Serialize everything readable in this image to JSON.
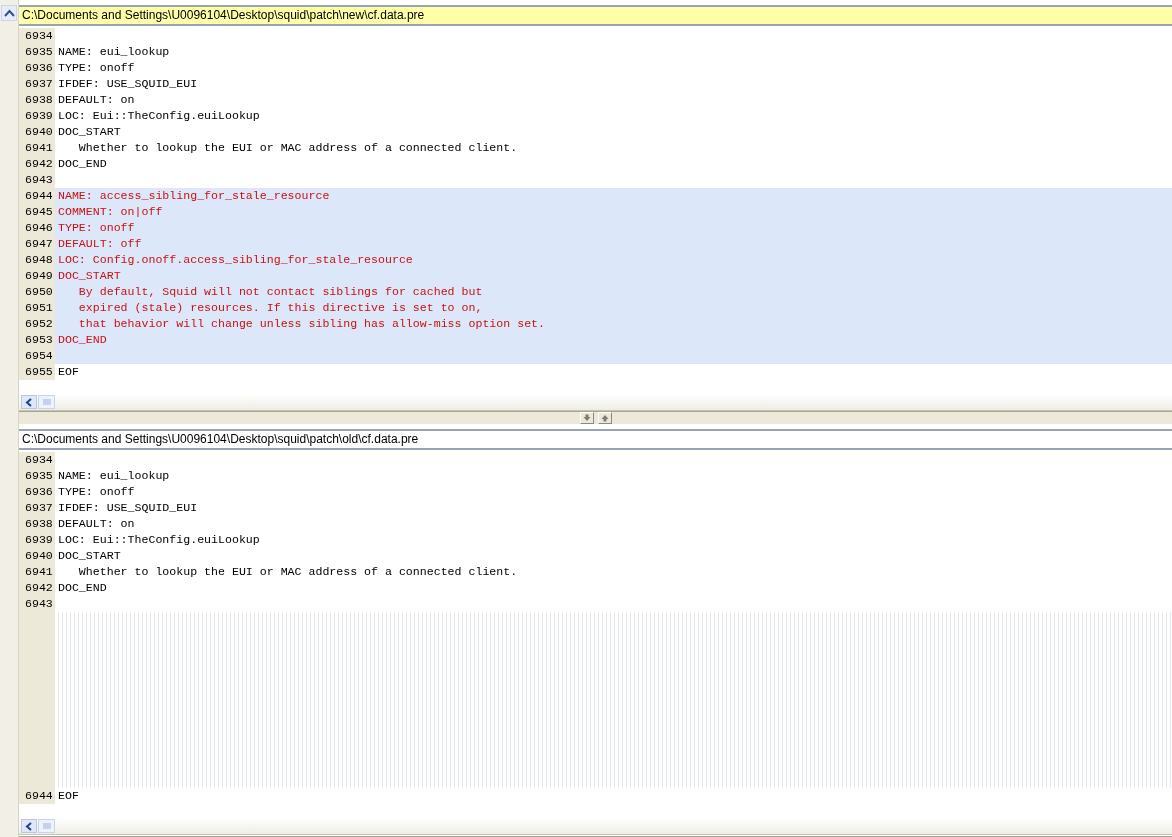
{
  "panes": [
    {
      "path": "C:\\Documents and Settings\\U0096104\\Desktop\\squid\\patch\\new\\cf.data.pre",
      "active": true,
      "lines": [
        {
          "kind": "line",
          "number": "6934",
          "changed": false
        },
        {
          "kind": "line",
          "number": "6935",
          "text": "NAME: eui_lookup",
          "changed": false
        },
        {
          "kind": "line",
          "number": "6936",
          "text": "TYPE: onoff",
          "changed": false
        },
        {
          "kind": "line",
          "number": "6937",
          "text": "IFDEF: USE_SQUID_EUI",
          "changed": false
        },
        {
          "kind": "line",
          "number": "6938",
          "text": "DEFAULT: on",
          "changed": false
        },
        {
          "kind": "line",
          "number": "6939",
          "text": "LOC: Eui::TheConfig.euiLookup",
          "changed": false
        },
        {
          "kind": "line",
          "number": "6940",
          "text": "DOC_START",
          "changed": false
        },
        {
          "kind": "line",
          "number": "6941",
          "text": "   Whether to lookup the EUI or MAC address of a connected client.",
          "changed": false
        },
        {
          "kind": "line",
          "number": "6942",
          "text": "DOC_END",
          "changed": false
        },
        {
          "kind": "line",
          "number": "6943",
          "changed": false
        },
        {
          "kind": "line",
          "number": "6944",
          "text": "NAME: access_sibling_for_stale_resource",
          "changed": true
        },
        {
          "kind": "line",
          "number": "6945",
          "text": "COMMENT: on|off",
          "changed": true
        },
        {
          "kind": "line",
          "number": "6946",
          "text": "TYPE: onoff",
          "changed": true
        },
        {
          "kind": "line",
          "number": "6947",
          "text": "DEFAULT: off",
          "changed": true
        },
        {
          "kind": "line",
          "number": "6948",
          "text": "LOC: Config.onoff.access_sibling_for_stale_resource",
          "changed": true
        },
        {
          "kind": "line",
          "number": "6949",
          "text": "DOC_START",
          "changed": true
        },
        {
          "kind": "line",
          "number": "6950",
          "text": "   By default, Squid will not contact siblings for cached but",
          "changed": true
        },
        {
          "kind": "line",
          "number": "6951",
          "text": "   expired (stale) resources. If this directive is set to on,",
          "changed": true
        },
        {
          "kind": "line",
          "number": "6952",
          "text": "   that behavior will change unless sibling has allow-miss option set.",
          "changed": true
        },
        {
          "kind": "line",
          "number": "6953",
          "text": "DOC_END",
          "changed": true
        },
        {
          "kind": "line",
          "number": "6954",
          "changed": true
        },
        {
          "kind": "line",
          "number": "6955",
          "text": "EOF",
          "changed": false
        }
      ]
    },
    {
      "path": "C:\\Documents and Settings\\U0096104\\Desktop\\squid\\patch\\old\\cf.data.pre",
      "active": false,
      "lines": [
        {
          "kind": "line",
          "number": "6934",
          "changed": false
        },
        {
          "kind": "line",
          "number": "6935",
          "text": "NAME: eui_lookup",
          "changed": false
        },
        {
          "kind": "line",
          "number": "6936",
          "text": "TYPE: onoff",
          "changed": false
        },
        {
          "kind": "line",
          "number": "6937",
          "text": "IFDEF: USE_SQUID_EUI",
          "changed": false
        },
        {
          "kind": "line",
          "number": "6938",
          "text": "DEFAULT: on",
          "changed": false
        },
        {
          "kind": "line",
          "number": "6939",
          "text": "LOC: Eui::TheConfig.euiLookup",
          "changed": false
        },
        {
          "kind": "line",
          "number": "6940",
          "text": "DOC_START",
          "changed": false
        },
        {
          "kind": "line",
          "number": "6941",
          "text": "   Whether to lookup the EUI or MAC address of a connected client.",
          "changed": false
        },
        {
          "kind": "line",
          "number": "6942",
          "text": "DOC_END",
          "changed": false
        },
        {
          "kind": "line",
          "number": "6943",
          "changed": false
        },
        {
          "kind": "filler"
        },
        {
          "kind": "line",
          "number": "6944",
          "text": "EOF",
          "changed": false
        }
      ]
    }
  ]
}
